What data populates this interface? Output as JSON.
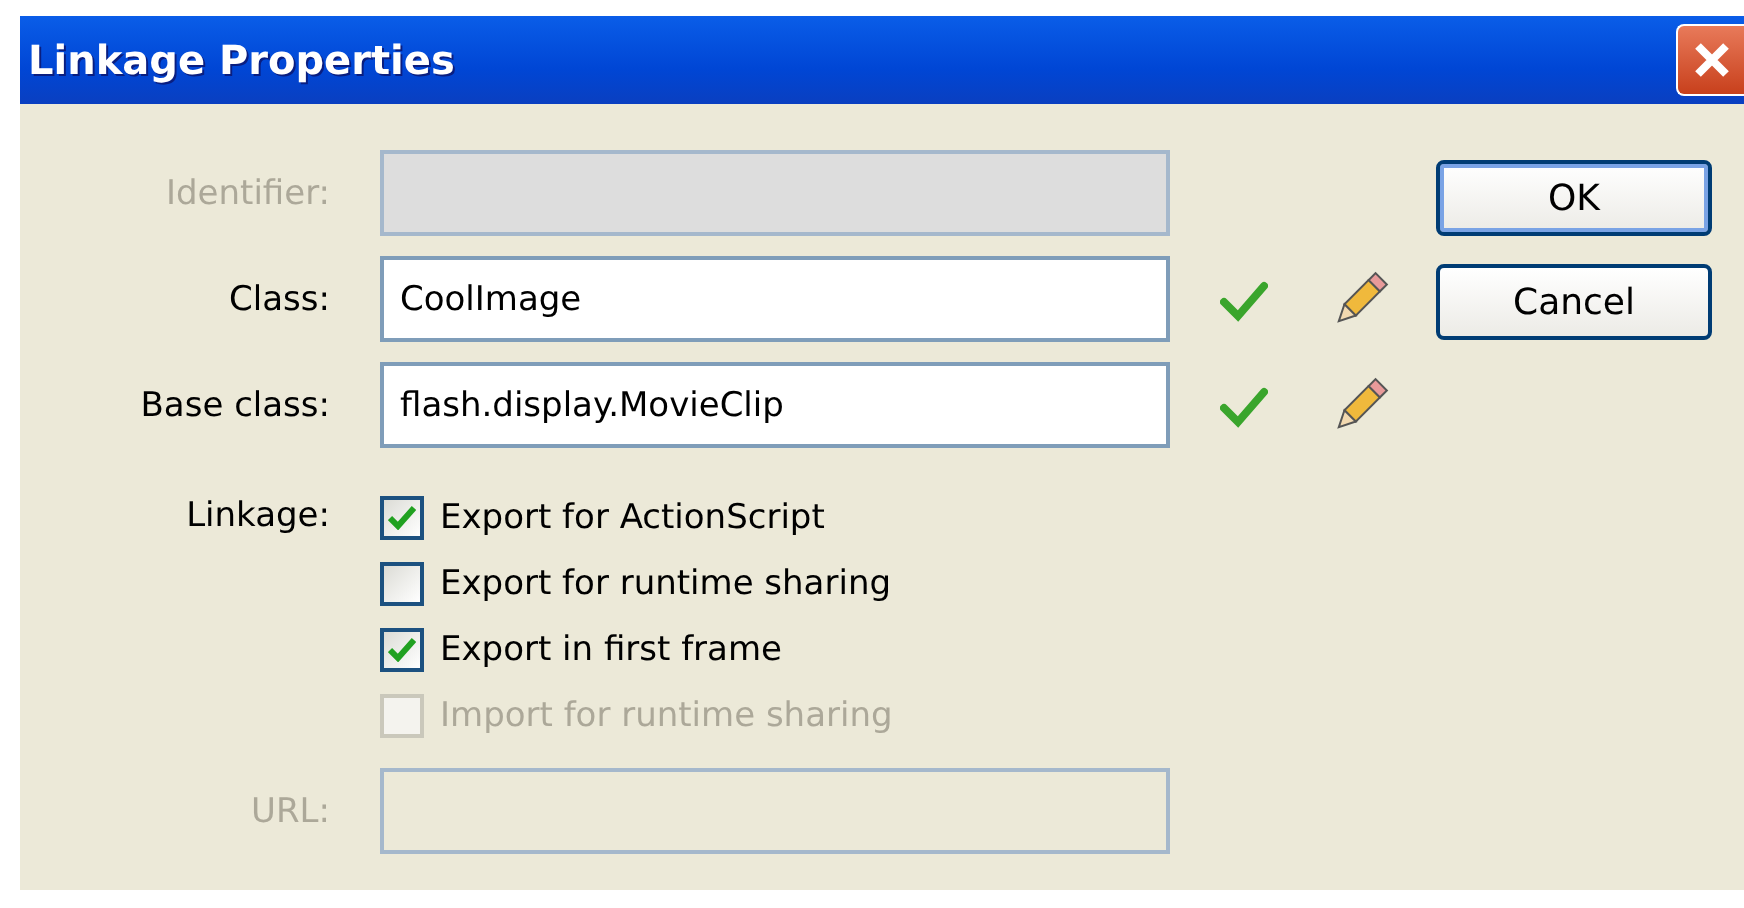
{
  "window": {
    "title": "Linkage Properties"
  },
  "fields": [
    {
      "label": "Identifier:",
      "disabled": true,
      "validated": false,
      "editable": false
    },
    {
      "label": "Class:",
      "value": "CoolImage",
      "disabled": false,
      "validated": true,
      "editable": true
    },
    {
      "label": "Base class:",
      "value": "flash.display.MovieClip",
      "disabled": false,
      "validated": true,
      "editable": true
    }
  ],
  "linkage": {
    "label": "Linkage:",
    "options": [
      {
        "label": "Export for ActionScript",
        "checked": true,
        "disabled": false
      },
      {
        "label": "Export for runtime sharing",
        "checked": false,
        "disabled": false
      },
      {
        "label": "Export in first frame",
        "checked": true,
        "disabled": false
      },
      {
        "label": "Import for runtime sharing",
        "checked": false,
        "disabled": true
      }
    ]
  },
  "url": {
    "label": "URL:",
    "disabled": true
  },
  "buttons": [
    {
      "label": "OK",
      "default": true
    },
    {
      "label": "Cancel",
      "default": false
    }
  ]
}
